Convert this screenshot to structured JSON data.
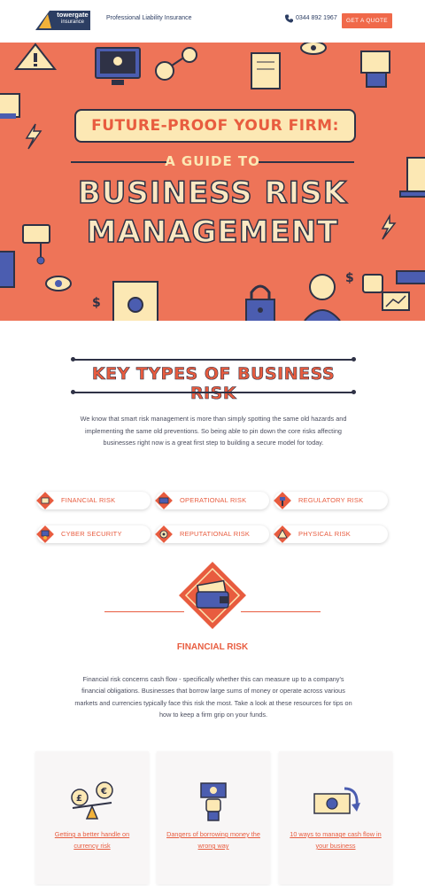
{
  "header": {
    "logo_line1": "towergate",
    "logo_line2": "insurance",
    "tagline": "Professional Liability Insurance",
    "phone": "0344 892 1967",
    "quote_button": "GET A QUOTE"
  },
  "hero": {
    "banner": "FUTURE-PROOF YOUR FIRM:",
    "subtitle": "A GUIDE TO",
    "title_line1": "BUSINESS RISK",
    "title_line2": "MANAGEMENT"
  },
  "key_types": {
    "title": "KEY TYPES OF BUSINESS RISK",
    "intro": "We know that smart risk management is more than simply spotting the same old hazards and implementing the same old preventions. So being able to pin down the core risks affecting businesses right now is a great first step to building a secure model for today.",
    "risks": [
      {
        "label": "FINANCIAL RISK",
        "icon": "money-icon"
      },
      {
        "label": "OPERATIONAL RISK",
        "icon": "machine-icon"
      },
      {
        "label": "REGULATORY RISK",
        "icon": "gavel-icon"
      },
      {
        "label": "CYBER SECURITY",
        "icon": "computer-shield-icon"
      },
      {
        "label": "REPUTATIONAL RISK",
        "icon": "target-icon"
      },
      {
        "label": "PHYSICAL RISK",
        "icon": "warning-icon"
      }
    ]
  },
  "financial": {
    "heading": "FINANCIAL RISK",
    "text": "Financial risk concerns cash flow - specifically whether this can measure up to a company's financial obligations. Businesses that borrow large sums of money or operate across various markets and currencies typically face this risk the most. Take a look at these resources for tips on how to keep a firm grip on your funds.",
    "cards": [
      {
        "link": "Getting a better handle on currency risk",
        "icon": "currency-scale-icon"
      },
      {
        "link": "Dangers of borrowing money the wrong way",
        "icon": "borrowing-money-icon"
      },
      {
        "link": "10 ways to manage cash flow in your business",
        "icon": "cash-flow-icon"
      }
    ]
  },
  "colors": {
    "accent": "#e85c3f",
    "hero_background": "#ee7458",
    "navy": "#2f3246",
    "cream": "#fce8b4"
  }
}
